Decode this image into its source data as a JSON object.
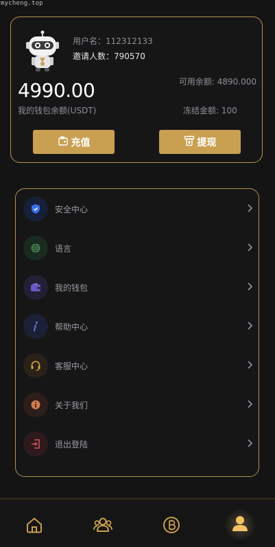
{
  "watermark": "mycheng.top",
  "profile": {
    "username_label": "用户名：",
    "username_value": "112312133",
    "invites_label": "邀请人数：",
    "invites_value": "790570",
    "wallet_balance": "4990.00",
    "wallet_balance_label": "我的钱包余额(USDT)",
    "available": "可用余额: 4890.000",
    "frozen": "冻结金额: 100",
    "recharge_label": "充值",
    "withdraw_label": "提现"
  },
  "menu": {
    "items": [
      {
        "label": "安全中心",
        "icon": "shield-icon"
      },
      {
        "label": "语言",
        "icon": "globe-icon"
      },
      {
        "label": "我的钱包",
        "icon": "wallet-icon"
      },
      {
        "label": "帮助中心",
        "icon": "info-italic-icon"
      },
      {
        "label": "客服中心",
        "icon": "headset-icon"
      },
      {
        "label": "关于我们",
        "icon": "info-circle-icon"
      },
      {
        "label": "退出登陆",
        "icon": "logout-icon"
      }
    ]
  },
  "tabs": [
    {
      "name": "home",
      "icon": "home-icon"
    },
    {
      "name": "team",
      "icon": "team-icon"
    },
    {
      "name": "bitcoin",
      "icon": "bitcoin-icon"
    },
    {
      "name": "me",
      "icon": "user-icon"
    }
  ],
  "colors": {
    "accent": "#c99f52",
    "background": "#141414",
    "border": "#b3944f"
  }
}
